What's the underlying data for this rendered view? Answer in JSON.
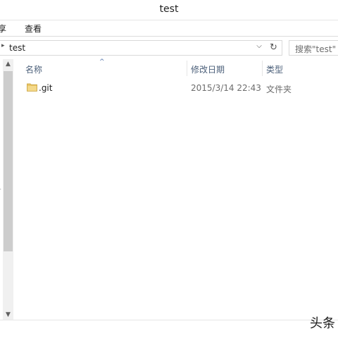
{
  "window": {
    "title": "test"
  },
  "ribbon": {
    "share_tab": "享",
    "view_tab": "查看"
  },
  "address": {
    "path": "test",
    "search_placeholder": "搜索\"test\""
  },
  "columns": {
    "name": "名称",
    "date": "修改日期",
    "type": "类型"
  },
  "files": [
    {
      "name": ".git",
      "date": "2015/3/14 22:43",
      "type": "文件夹",
      "icon": "folder-icon"
    }
  ],
  "watermark": "头条"
}
